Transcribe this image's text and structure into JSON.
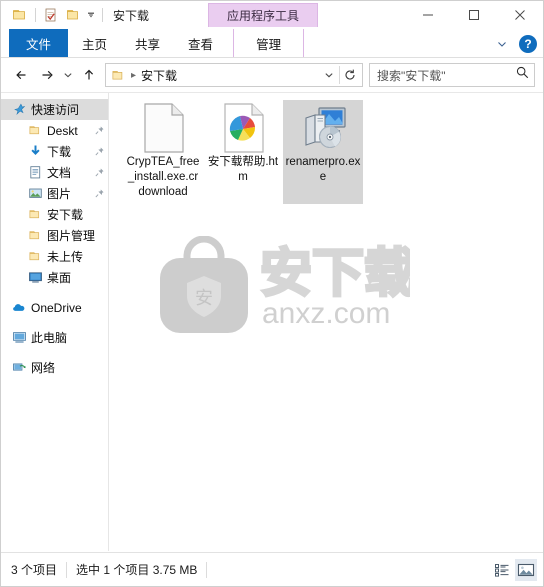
{
  "window": {
    "title": "安下载",
    "contextual_tab_group": "应用程序工具",
    "quick_access": [
      {
        "name": "folder-icon",
        "label": "新建文件夹"
      },
      {
        "name": "properties-icon",
        "label": "属性"
      },
      {
        "name": "folder-icon",
        "label": "文件夹"
      }
    ],
    "controls": {
      "minimize": "最小化",
      "maximize": "最大化",
      "close": "关闭"
    }
  },
  "ribbon": {
    "tabs": [
      {
        "label": "文件",
        "state": "file"
      },
      {
        "label": "主页",
        "state": "normal"
      },
      {
        "label": "共享",
        "state": "normal"
      },
      {
        "label": "查看",
        "state": "normal"
      },
      {
        "label": "管理",
        "state": "contextual"
      }
    ],
    "collapse_label": "展开功能区",
    "help_label": "?"
  },
  "address": {
    "back": "后退",
    "forward": "前进",
    "history": "最近浏览的位置",
    "up": "上移到",
    "crumb": "安下载",
    "dropdown": "以前的位置",
    "refresh": "刷新",
    "search_placeholder": "搜索\"安下载\""
  },
  "sidebar": {
    "items": [
      {
        "label": "快速访问",
        "icon": "star-icon",
        "level": 0,
        "selected": true,
        "pinned": false
      },
      {
        "label": "Deskt",
        "icon": "folder-icon",
        "level": 1,
        "selected": false,
        "pinned": true
      },
      {
        "label": "下载",
        "icon": "download-icon",
        "level": 1,
        "selected": false,
        "pinned": true
      },
      {
        "label": "文档",
        "icon": "document-icon",
        "level": 1,
        "selected": false,
        "pinned": true
      },
      {
        "label": "图片",
        "icon": "pictures-icon",
        "level": 1,
        "selected": false,
        "pinned": true
      },
      {
        "label": "安下载",
        "icon": "folder-icon",
        "level": 1,
        "selected": false,
        "pinned": false
      },
      {
        "label": "图片管理",
        "icon": "folder-icon",
        "level": 1,
        "selected": false,
        "pinned": false
      },
      {
        "label": "未上传",
        "icon": "folder-icon",
        "level": 1,
        "selected": false,
        "pinned": false
      },
      {
        "label": "桌面",
        "icon": "desktop-icon",
        "level": 1,
        "selected": false,
        "pinned": false
      },
      {
        "label": "OneDrive",
        "icon": "onedrive-icon",
        "level": 0,
        "selected": false,
        "pinned": false
      },
      {
        "label": "此电脑",
        "icon": "this-pc-icon",
        "level": 0,
        "selected": false,
        "pinned": false
      },
      {
        "label": "网络",
        "icon": "network-icon",
        "level": 0,
        "selected": false,
        "pinned": false
      }
    ]
  },
  "files": [
    {
      "name": "CrypTEA_free_install.exe.crdownload",
      "icon": "blank-file-icon",
      "selected": false
    },
    {
      "name": "安下载帮助.htm",
      "icon": "html-file-icon",
      "selected": false
    },
    {
      "name": "renamerpro.exe",
      "icon": "application-exe-icon",
      "selected": true
    }
  ],
  "watermark": {
    "logo_char": "安",
    "brand": "安下载",
    "domain": "anxz.com"
  },
  "status": {
    "item_count": "3 个项目",
    "selection": "选中 1 个项目  3.75 MB",
    "views": [
      {
        "name": "details-view-icon",
        "label": "详细信息",
        "active": false
      },
      {
        "name": "large-icons-view-icon",
        "label": "大图标",
        "active": true
      }
    ]
  },
  "colors": {
    "accent": "#0f6cbd",
    "contextual": "#eacdf0",
    "selection": "#d5d5d5",
    "nav_selection": "#dcdcdc",
    "watermark_gray": "#d3d3d3"
  }
}
